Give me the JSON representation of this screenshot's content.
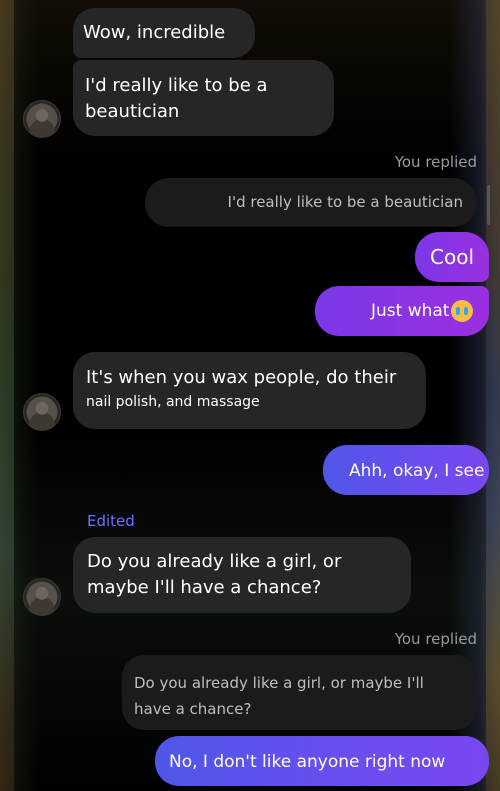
{
  "messages": {
    "m1": "Wow, incredible",
    "m2": "I'd really like to be a beautician",
    "you_replied_1": "You replied",
    "quoted_1": "I'd really like to be a beautician",
    "m3": "Cool",
    "m4": "Just what",
    "m5_line1": "It's when you wax people, do their",
    "m5_line2": "nail polish, and massage",
    "m6": "Ahh, okay, I see",
    "edited_label": "Edited",
    "m7": "Do you already like a girl, or maybe I'll have a chance?",
    "you_replied_2": "You replied",
    "quoted_2": "Do you already like a girl, or maybe I'll have a chance?",
    "m8": "No, I don't like anyone right now"
  },
  "icons": {
    "emoji": "crying-face-emoji",
    "avatar": "contact-avatar"
  },
  "colors": {
    "incoming_bubble": "#262626",
    "outgoing_purple": "#8b34e3",
    "outgoing_blue": "#5b52ec",
    "edited_label": "#6f72ff"
  }
}
